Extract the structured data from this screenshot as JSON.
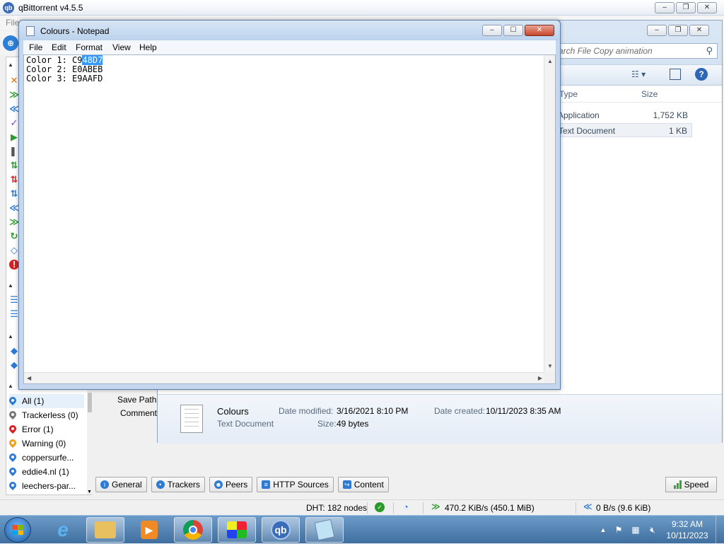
{
  "qbittorrent": {
    "title": "qBittorrent v4.5.5",
    "menu_first": "File",
    "trackers": [
      {
        "label": "All (1)",
        "color": "#2e7bd3"
      },
      {
        "label": "Trackerless (0)",
        "color": "#777777"
      },
      {
        "label": "Error (1)",
        "color": "#d62020"
      },
      {
        "label": "Warning (0)",
        "color": "#f0a020"
      },
      {
        "label": "coppersurfe...",
        "color": "#2e7bd3"
      },
      {
        "label": "eddie4.nl (1)",
        "color": "#2e7bd3"
      },
      {
        "label": "leechers-par...",
        "color": "#2e7bd3"
      }
    ],
    "props": {
      "save_path_label": "Save Path:",
      "comment_label": "Comment:"
    },
    "tabs": [
      "General",
      "Trackers",
      "Peers",
      "HTTP Sources",
      "Content"
    ],
    "speed_label": "Speed",
    "status": {
      "dht": "DHT: 182 nodes",
      "download": "470.2 KiB/s (450.1 MiB)",
      "upload": "0 B/s (9.6 KiB)"
    }
  },
  "explorer": {
    "search_placeholder": "arch File Copy animation",
    "columns": {
      "type": "Type",
      "size": "Size"
    },
    "rows": [
      {
        "type": "Application",
        "size": "1,752 KB"
      },
      {
        "type": "Text Document",
        "size": "1 KB"
      }
    ],
    "details": {
      "name": "Colours",
      "kind": "Text Document",
      "date_modified_label": "Date modified:",
      "date_modified": "3/16/2021 8:10 PM",
      "size_label": "Size:",
      "size": "49 bytes",
      "date_created_label": "Date created:",
      "date_created": "10/11/2023 8:35 AM"
    }
  },
  "notepad": {
    "title": "Colours - Notepad",
    "menu": [
      "File",
      "Edit",
      "Format",
      "View",
      "Help"
    ],
    "lines": [
      {
        "prefix": "Color 1: C9",
        "selected": "48D7"
      },
      {
        "prefix": "Color 2: E0ABEB",
        "selected": ""
      },
      {
        "prefix": "Color 3: E9AAFD",
        "selected": ""
      }
    ]
  },
  "taskbar": {
    "time": "9:32 AM",
    "date": "10/11/2023",
    "apps": [
      "internet-explorer",
      "file-explorer",
      "media-player",
      "chrome",
      "paint",
      "qbittorrent",
      "notepad"
    ]
  }
}
